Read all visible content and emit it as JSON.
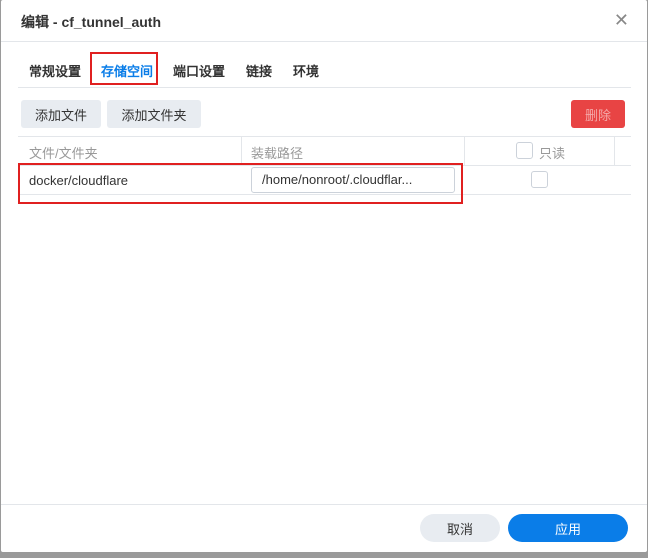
{
  "title": "编辑 - cf_tunnel_auth",
  "tabs": [
    "常规设置",
    "存储空间",
    "端口设置",
    "链接",
    "环境"
  ],
  "toolbar": {
    "add_file": "添加文件",
    "add_folder": "添加文件夹",
    "delete": "删除"
  },
  "table": {
    "headers": [
      "文件/文件夹",
      "装载路径",
      "只读"
    ],
    "rows": [
      {
        "file": "docker/cloudflare",
        "mount": "/home/nonroot/.cloudflar...",
        "readonly": false
      }
    ]
  },
  "footer": {
    "cancel": "取消",
    "apply": "应用"
  }
}
